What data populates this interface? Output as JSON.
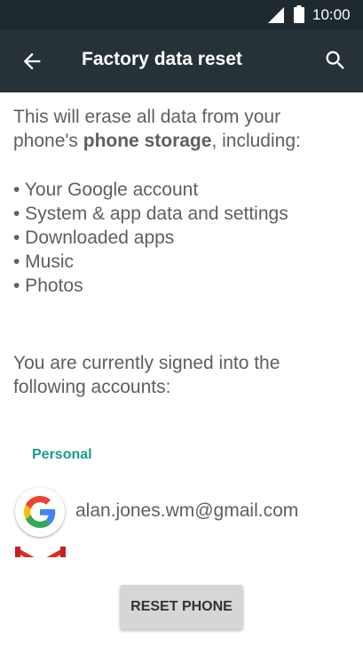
{
  "status_bar": {
    "time": "10:00",
    "icons": [
      "signal-icon",
      "battery-icon"
    ]
  },
  "app_bar": {
    "title": "Factory data reset",
    "back_icon": "arrow-left-icon",
    "search_icon": "search-icon",
    "background": "#263238"
  },
  "warning": {
    "line1": "This will erase all data from your",
    "line2_prefix": "phone's ",
    "line2_bold": "phone storage",
    "line2_suffix": ", including:"
  },
  "erase_items": [
    "• Your Google account",
    "• System & app data and settings",
    "• Downloaded apps",
    "• Music",
    "• Photos"
  ],
  "accounts_intro": {
    "line1": "You are currently signed into the",
    "line2": "following accounts:"
  },
  "accounts": {
    "section_label": "Personal",
    "section_color": "#1e9a8a",
    "items": [
      {
        "email": "alan.jones.wm@gmail.com",
        "icon": "google-icon"
      }
    ],
    "partial_item_icon": "gmail-icon"
  },
  "reset_button": {
    "label": "RESET PHONE"
  }
}
